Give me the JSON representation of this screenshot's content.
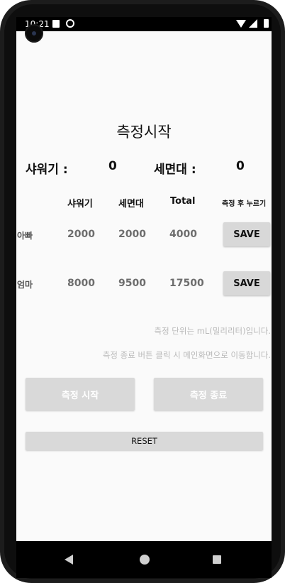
{
  "status_bar": {
    "time": "10:21"
  },
  "app": {
    "title": "측정시작",
    "summary": {
      "shower_label": "샤워기 :",
      "shower_value": "0",
      "sink_label": "세면대 :",
      "sink_value": "0"
    },
    "table": {
      "headers": [
        "샤워기",
        "세면대",
        "Total",
        "측정 후 누르기"
      ],
      "rows": [
        {
          "label": "아빠",
          "shower": "2000",
          "sink": "2000",
          "total": "4000",
          "button": "SAVE"
        },
        {
          "label": "엄마",
          "shower": "8000",
          "sink": "9500",
          "total": "17500",
          "button": "SAVE"
        }
      ]
    },
    "notes": [
      "측정 단위는 mL(밀리리터)입니다.",
      "측정 종료 버튼 클릭 시 메인화면으로 이동합니다."
    ],
    "buttons": {
      "start": "측정 시작",
      "end": "측정 종료",
      "reset": "RESET"
    }
  }
}
